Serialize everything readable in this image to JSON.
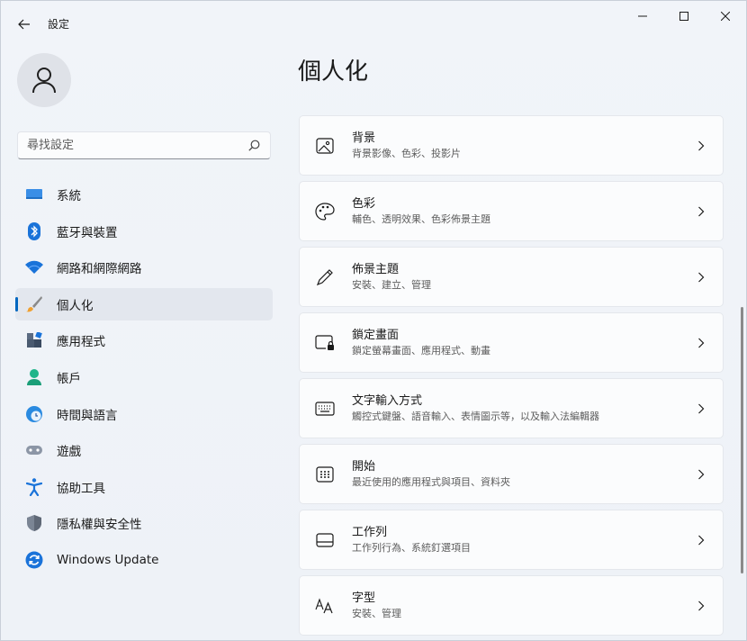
{
  "app": {
    "title": "設定"
  },
  "user": {
    "avatar_icon": "person-icon"
  },
  "search": {
    "placeholder": "尋找設定"
  },
  "nav": {
    "items": [
      {
        "label": "系統",
        "icon": "system-icon"
      },
      {
        "label": "藍牙與裝置",
        "icon": "bluetooth-icon"
      },
      {
        "label": "網路和網際網路",
        "icon": "wifi-icon"
      },
      {
        "label": "個人化",
        "icon": "brush-icon",
        "selected": true
      },
      {
        "label": "應用程式",
        "icon": "apps-icon"
      },
      {
        "label": "帳戶",
        "icon": "account-icon"
      },
      {
        "label": "時間與語言",
        "icon": "time-language-icon"
      },
      {
        "label": "遊戲",
        "icon": "gamepad-icon"
      },
      {
        "label": "協助工具",
        "icon": "accessibility-icon"
      },
      {
        "label": "隱私權與安全性",
        "icon": "shield-icon"
      },
      {
        "label": "Windows Update",
        "icon": "windows-update-icon"
      }
    ]
  },
  "main": {
    "title": "個人化",
    "cards": [
      {
        "title": "背景",
        "subtitle": "背景影像、色彩、投影片",
        "icon": "image-icon"
      },
      {
        "title": "色彩",
        "subtitle": "輔色、透明效果、色彩佈景主題",
        "icon": "palette-icon"
      },
      {
        "title": "佈景主題",
        "subtitle": "安裝、建立、管理",
        "icon": "pen-icon"
      },
      {
        "title": "鎖定畫面",
        "subtitle": "鎖定螢幕畫面、應用程式、動畫",
        "icon": "lock-screen-icon"
      },
      {
        "title": "文字輸入方式",
        "subtitle": "觸控式鍵盤、語音輸入、表情圖示等，以及輸入法編輯器",
        "icon": "keyboard-icon"
      },
      {
        "title": "開始",
        "subtitle": "最近使用的應用程式與項目、資料夾",
        "icon": "start-icon"
      },
      {
        "title": "工作列",
        "subtitle": "工作列行為、系統釘選項目",
        "icon": "taskbar-icon"
      },
      {
        "title": "字型",
        "subtitle": "安裝、管理",
        "icon": "font-icon"
      }
    ]
  },
  "colors": {
    "accent": "#0067c0"
  }
}
